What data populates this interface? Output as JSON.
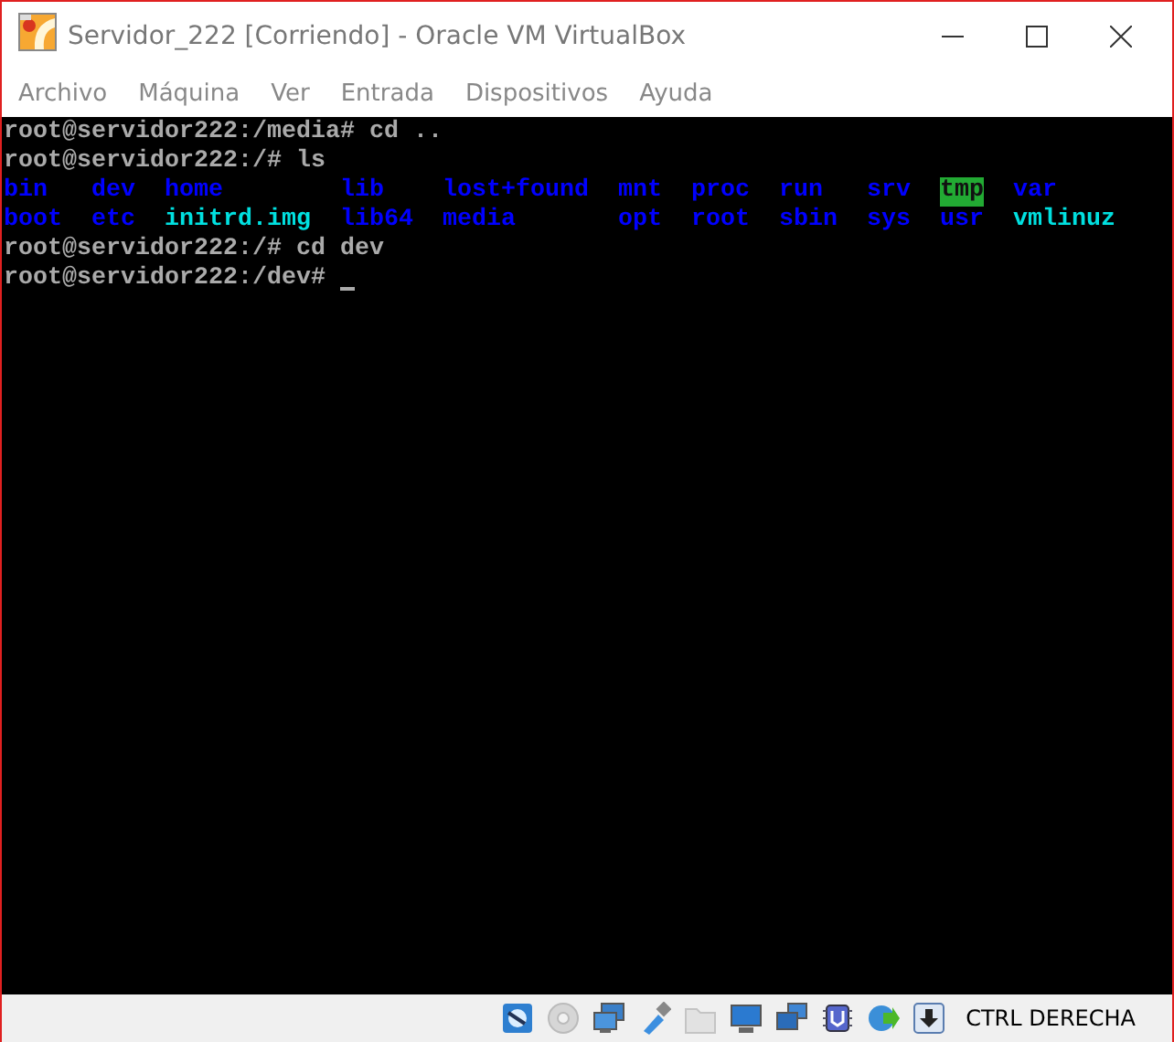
{
  "window": {
    "title": "Servidor_222 [Corriendo] - Oracle VM VirtualBox"
  },
  "menu": [
    "Archivo",
    "Máquina",
    "Ver",
    "Entrada",
    "Dispositivos",
    "Ayuda"
  ],
  "terminal": {
    "lines_before": [
      {
        "prompt": "root@servidor222:/media#",
        "command": "cd .."
      },
      {
        "prompt": "root@servidor222:/#",
        "command": "ls"
      }
    ],
    "ls_columns": [
      [
        {
          "name": "bin",
          "kind": "dir"
        },
        {
          "name": "boot",
          "kind": "dir"
        }
      ],
      [
        {
          "name": "dev",
          "kind": "dir"
        },
        {
          "name": "etc",
          "kind": "dir"
        }
      ],
      [
        {
          "name": "home",
          "kind": "dir"
        },
        {
          "name": "initrd.img",
          "kind": "link"
        }
      ],
      [
        {
          "name": "lib",
          "kind": "dir"
        },
        {
          "name": "lib64",
          "kind": "dir"
        }
      ],
      [
        {
          "name": "lost+found",
          "kind": "dir"
        },
        {
          "name": "media",
          "kind": "dir"
        }
      ],
      [
        {
          "name": "mnt",
          "kind": "dir"
        },
        {
          "name": "opt",
          "kind": "dir"
        }
      ],
      [
        {
          "name": "proc",
          "kind": "dir"
        },
        {
          "name": "root",
          "kind": "dir"
        }
      ],
      [
        {
          "name": "run",
          "kind": "dir"
        },
        {
          "name": "sbin",
          "kind": "dir"
        }
      ],
      [
        {
          "name": "srv",
          "kind": "dir"
        },
        {
          "name": "sys",
          "kind": "dir"
        }
      ],
      [
        {
          "name": "tmp",
          "kind": "sticky"
        },
        {
          "name": "usr",
          "kind": "dir"
        }
      ],
      [
        {
          "name": "var",
          "kind": "dir"
        },
        {
          "name": "vmlinuz",
          "kind": "link"
        }
      ]
    ],
    "lines_after": [
      {
        "prompt": "root@servidor222:/#",
        "command": "cd dev"
      },
      {
        "prompt": "root@servidor222:/dev#"
      }
    ]
  },
  "status_bar": {
    "icons": [
      {
        "kind": "disk",
        "disabled": false
      },
      {
        "kind": "disc",
        "disabled": true
      },
      {
        "kind": "network",
        "disabled": false
      },
      {
        "kind": "usb",
        "disabled": false
      },
      {
        "kind": "folder",
        "disabled": true
      },
      {
        "kind": "display",
        "disabled": false
      },
      {
        "kind": "screens",
        "disabled": false
      },
      {
        "kind": "chip",
        "disabled": false
      },
      {
        "kind": "globe",
        "disabled": false
      },
      {
        "kind": "download",
        "disabled": false
      }
    ],
    "host_key": "CTRL DERECHA"
  }
}
